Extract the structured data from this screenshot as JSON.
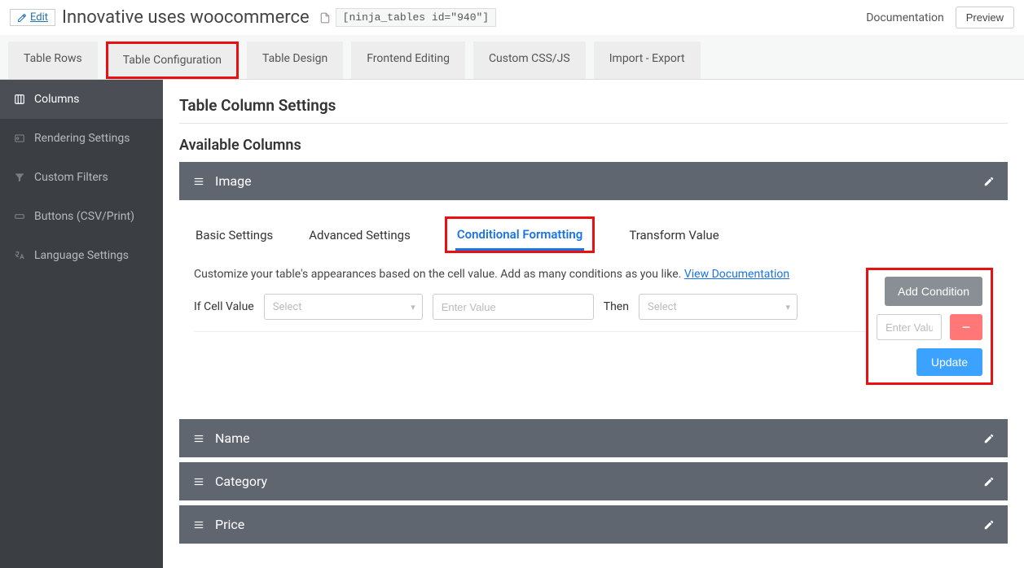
{
  "top": {
    "edit_label": "Edit",
    "title": "Innovative uses woocommerce",
    "shortcode": "[ninja_tables id=\"940\"]",
    "documentation": "Documentation",
    "preview": "Preview"
  },
  "tabs": {
    "rows": "Table Rows",
    "config": "Table Configuration",
    "design": "Table Design",
    "frontend": "Frontend Editing",
    "css": "Custom CSS/JS",
    "import": "Import - Export"
  },
  "sidebar": {
    "columns": "Columns",
    "rendering": "Rendering Settings",
    "filters": "Custom Filters",
    "buttons": "Buttons (CSV/Print)",
    "language": "Language Settings"
  },
  "main": {
    "heading": "Table Column Settings",
    "subheading": "Available Columns"
  },
  "columns": {
    "image": "Image",
    "name": "Name",
    "category": "Category",
    "price": "Price"
  },
  "subtabs": {
    "basic": "Basic Settings",
    "advanced": "Advanced Settings",
    "conditional": "Conditional Formatting",
    "transform": "Transform Value"
  },
  "cond": {
    "desc_prefix": "Customize your table's appearances based on the cell value. Add as many conditions as you like. ",
    "view_doc": "View Documentation",
    "add_condition": "Add Condition",
    "if_label": "If Cell Value",
    "then_label": "Then",
    "select_ph": "Select",
    "value_ph": "Enter Value",
    "update": "Update"
  }
}
